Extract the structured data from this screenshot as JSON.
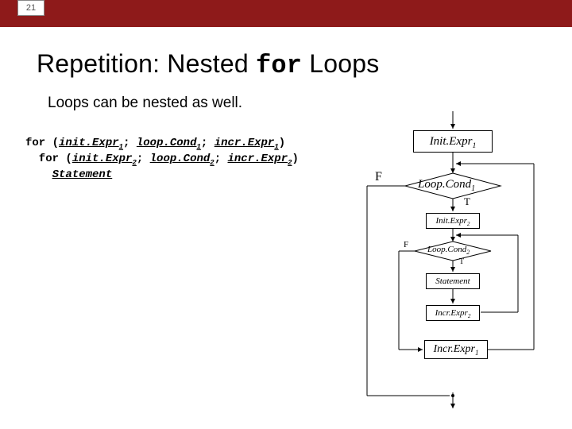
{
  "slide_number": "21",
  "title_pre": "Repetition: Nested ",
  "title_kw": "for",
  "title_post": " Loops",
  "subtitle": "Loops can be nested as well.",
  "code": {
    "l1_a": "for (",
    "l1_b": "init.Expr",
    "l1_s1": "1",
    "l1_c": "; ",
    "l1_d": "loop.Cond",
    "l1_s2": "1",
    "l1_e": "; ",
    "l1_f": "incr.Expr",
    "l1_s3": "1",
    "l1_g": ")",
    "l2_a": "  for (",
    "l2_b": "init.Expr",
    "l2_s1": "2",
    "l2_c": "; ",
    "l2_d": "loop.Cond",
    "l2_s2": "2",
    "l2_e": "; ",
    "l2_f": "incr.Expr",
    "l2_s3": "2",
    "l2_g": ")",
    "l3_a": "    ",
    "l3_b": "Statement"
  },
  "diagram": {
    "init1": "Init.Expr",
    "init1_sub": "1",
    "cond1": "Loop.Cond",
    "cond1_sub": "1",
    "init2": "Init.Expr",
    "init2_sub": "2",
    "cond2": "Loop.Cond",
    "cond2_sub": "2",
    "stmt": "Statement",
    "incr2": "Incr.Expr",
    "incr2_sub": "2",
    "incr1": "Incr.Expr",
    "incr1_sub": "1",
    "F": "F",
    "T": "T"
  }
}
